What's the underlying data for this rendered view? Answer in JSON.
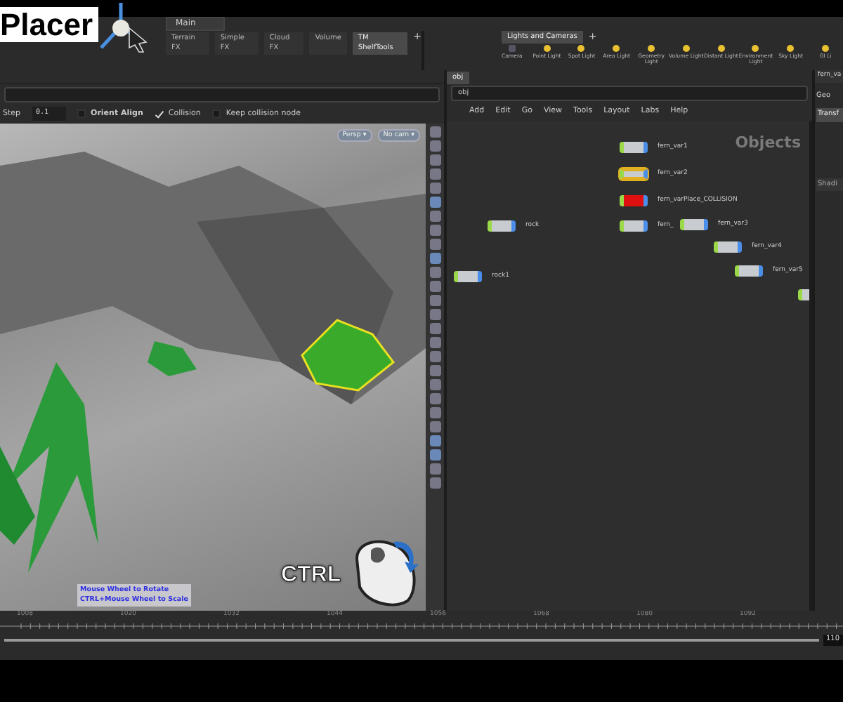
{
  "overlay": {
    "title": "Placer",
    "key_hint": "CTRL"
  },
  "desktop": {
    "selector": "Main"
  },
  "shelf_tabs": [
    {
      "label": "Terrain FX",
      "selected": false
    },
    {
      "label": "Simple FX",
      "selected": false
    },
    {
      "label": "Cloud FX",
      "selected": false
    },
    {
      "label": "Volume",
      "selected": false
    },
    {
      "label": "TM ShelfTools",
      "selected": true
    }
  ],
  "shelf_add": "+",
  "light_shelf": {
    "tab": "Lights and Cameras",
    "add": "+",
    "tools": [
      {
        "label": "Camera",
        "kind": "camera"
      },
      {
        "label": "Point Light",
        "kind": "light"
      },
      {
        "label": "Spot Light",
        "kind": "light"
      },
      {
        "label": "Area Light",
        "kind": "light"
      },
      {
        "label": "Geometry Light",
        "kind": "light"
      },
      {
        "label": "Volume Light",
        "kind": "light"
      },
      {
        "label": "Distant Light",
        "kind": "light"
      },
      {
        "label": "Environment Light",
        "kind": "light"
      },
      {
        "label": "Sky Light",
        "kind": "light"
      },
      {
        "label": "GI Li",
        "kind": "light"
      }
    ]
  },
  "tool_options": {
    "step_label": "Step",
    "step_value": "0.1",
    "options": [
      {
        "label": "Orient Align",
        "checked": false
      },
      {
        "label": "Collision",
        "checked": true
      },
      {
        "label": "Keep collision node",
        "checked": false
      }
    ]
  },
  "viewport": {
    "view_menu": "Persp ▾",
    "camera_menu": "No cam ▾",
    "hints": [
      "Mouse Wheel to Rotate",
      "CTRL+Mouse Wheel to Scale"
    ]
  },
  "network": {
    "tab": "obj",
    "path": "obj",
    "menu": [
      "Add",
      "Edit",
      "Go",
      "View",
      "Tools",
      "Layout",
      "Labs",
      "Help"
    ],
    "context": "Objects",
    "nodes": [
      {
        "label": "fern_var1",
        "selected": false,
        "color": "#c8ccd0"
      },
      {
        "label": "fern_var2",
        "selected": true,
        "color": "#c8ccd0"
      },
      {
        "label": "fern_varPlace_COLLISION",
        "selected": false,
        "color": "#e01010"
      },
      {
        "label": "rock",
        "selected": false,
        "color": "#c8ccd0"
      },
      {
        "label": "fern_",
        "selected": false,
        "color": "#c8ccd0"
      },
      {
        "label": "fern_var3",
        "selected": false,
        "color": "#c8ccd0"
      },
      {
        "label": "fern_var4",
        "selected": false,
        "color": "#c8ccd0"
      },
      {
        "label": "rock1",
        "selected": false,
        "color": "#c8ccd0"
      },
      {
        "label": "fern_var5",
        "selected": false,
        "color": "#c8ccd0"
      }
    ]
  },
  "parameters": {
    "header": "fern_va",
    "type": "Geo",
    "tabs": [
      {
        "label": "Transf",
        "selected": true
      },
      {
        "label": "Shadi",
        "selected": false
      }
    ]
  },
  "timeline": {
    "level": 1,
    "ticks": [
      "1008",
      "1020",
      "1032",
      "1044",
      "1056",
      "1068",
      "1080",
      "1092"
    ],
    "end_frame": "110"
  }
}
